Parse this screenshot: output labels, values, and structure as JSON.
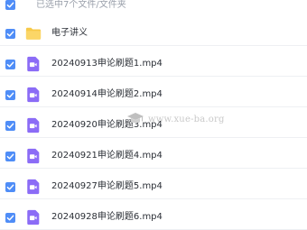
{
  "header": {
    "selection_text": "已选中7个文件/文件夹"
  },
  "items": [
    {
      "name": "电子讲义",
      "type": "folder",
      "icon": "folder-icon",
      "checked": true
    },
    {
      "name": "20240913申论刷题1.mp4",
      "type": "video",
      "icon": "video-file-icon",
      "checked": true
    },
    {
      "name": "20240914申论刷题2.mp4",
      "type": "video",
      "icon": "video-file-icon",
      "checked": true
    },
    {
      "name": "20240920申论刷题3.mp4",
      "type": "video",
      "icon": "video-file-icon",
      "checked": true
    },
    {
      "name": "20240921申论刷题4.mp4",
      "type": "video",
      "icon": "video-file-icon",
      "checked": true
    },
    {
      "name": "20240927申论刷题5.mp4",
      "type": "video",
      "icon": "video-file-icon",
      "checked": true
    },
    {
      "name": "20240928申论刷题6.mp4",
      "type": "video",
      "icon": "video-file-icon",
      "checked": true
    }
  ],
  "watermark": {
    "text": "www.xue-ba.org",
    "icon": "graduation-cap-icon"
  },
  "colors": {
    "checkbox": "#4f8df7",
    "folder": "#f7c948",
    "video": "#8b6cf6"
  }
}
